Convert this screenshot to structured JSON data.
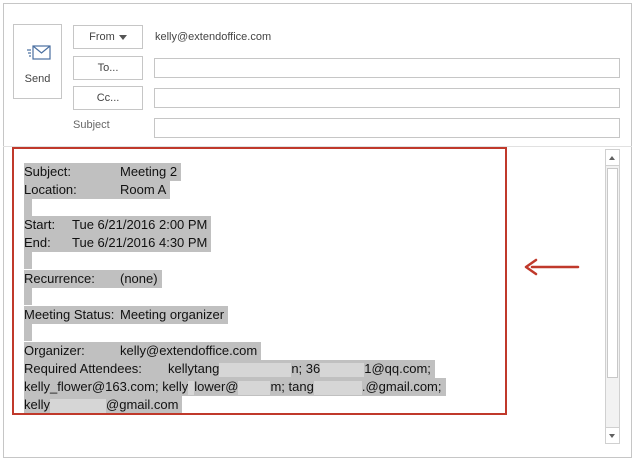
{
  "toolbar": {
    "send_label": "Send",
    "from_label": "From",
    "to_label": "To...",
    "cc_label": "Cc...",
    "subject_label": "Subject"
  },
  "header": {
    "from_address": "kelly@extendoffice.com",
    "to_value": "",
    "cc_value": "",
    "subject_value": ""
  },
  "message": {
    "subject_label": "Subject:",
    "subject_value": "Meeting 2",
    "location_label": "Location:",
    "location_value": "Room A",
    "start_label": "Start:",
    "start_value": "Tue 6/21/2016 2:00 PM",
    "end_label": "End:",
    "end_value": "Tue 6/21/2016 4:30 PM",
    "recurrence_label": "Recurrence:",
    "recurrence_value": "(none)",
    "status_label": "Meeting Status:",
    "status_value": "Meeting organizer",
    "organizer_label": "Organizer:",
    "organizer_value": "kelly@extendoffice.com",
    "attendees_label": "Required Attendees:",
    "att1_prefix": "kellytang",
    "att1_suffix": "n; 36",
    "att2_suffix": "1@qq.com;",
    "att3": "kelly_flower@163.com; kelly",
    "att4_suffix": "lower@",
    "att5_suffix": "m; tang",
    "att6_suffix": ".@gmail.com;",
    "att7_prefix": "kelly",
    "att7_suffix": "@gmail.com"
  },
  "colors": {
    "highlight_border": "#c0392b",
    "arrow": "#c0392b",
    "selection": "#c0c0c0"
  },
  "icons": {
    "send": "send-envelope-icon",
    "arrow": "left-arrow-icon"
  }
}
